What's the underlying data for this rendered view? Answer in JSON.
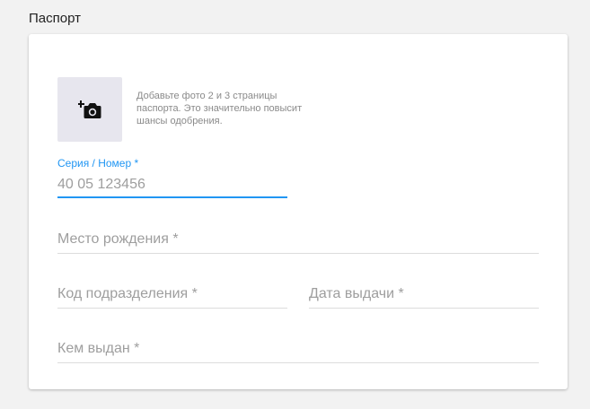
{
  "section": {
    "title": "Паспорт"
  },
  "photo": {
    "icon": "add-photo-camera-icon",
    "hint": "Добавьте фото 2 и 3 страницы паспорта. Это значительно повысит шансы одобрения."
  },
  "fields": {
    "series_number": {
      "label": "Серия / Номер *",
      "value": "40 05 123456"
    },
    "birthplace": {
      "placeholder": "Место рождения *"
    },
    "division_code": {
      "placeholder": "Код подразделения *"
    },
    "issue_date": {
      "placeholder": "Дата выдачи *"
    },
    "issued_by": {
      "placeholder": "Кем выдан *"
    }
  },
  "colors": {
    "accent": "#2196f3",
    "photo_bg": "#e7e6ee",
    "placeholder": "#9e9e9e",
    "underline": "#dcdcdc"
  }
}
